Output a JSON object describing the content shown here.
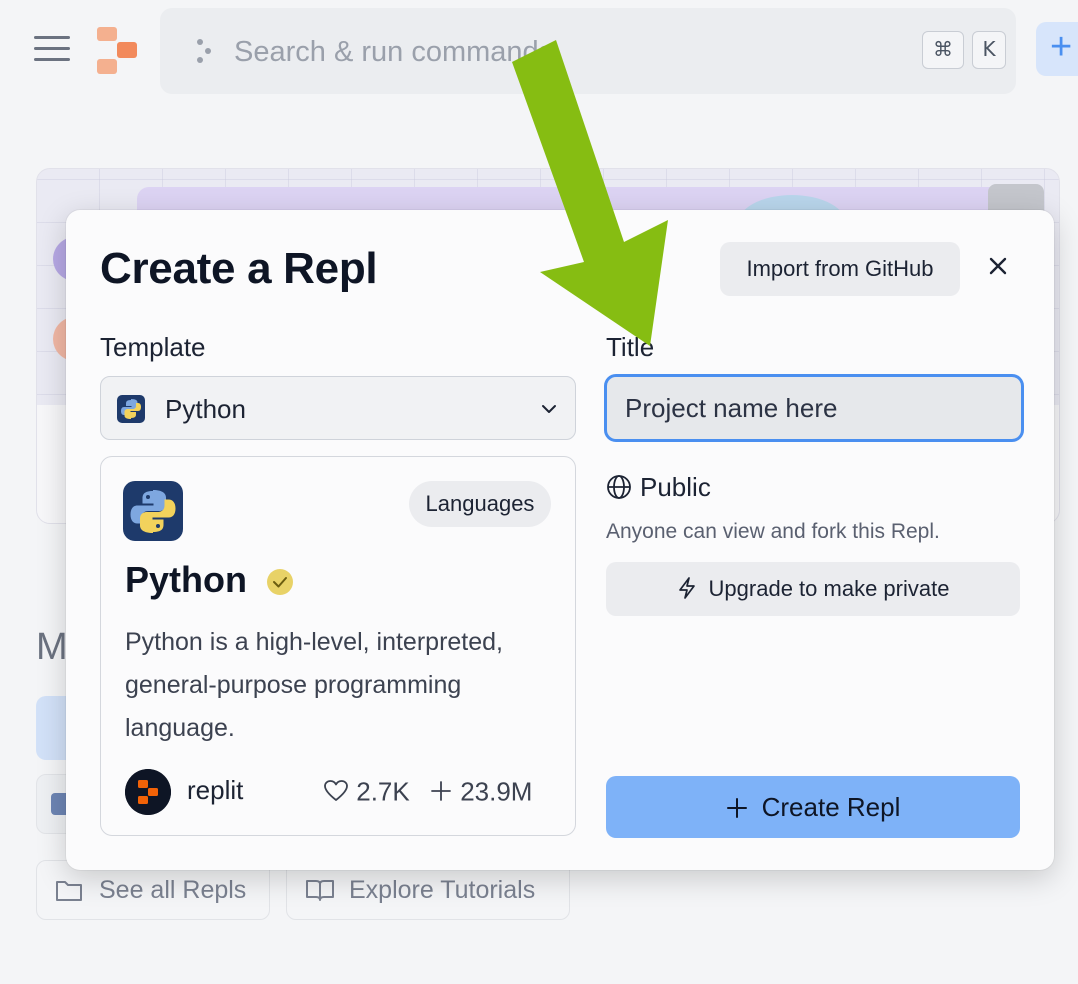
{
  "topbar": {
    "search_placeholder": "Search & run commands",
    "shortcut_keys": [
      "⌘",
      "K"
    ]
  },
  "background": {
    "section_letter": "M",
    "see_all_label": "See all Repls",
    "explore_label": "Explore Tutorials"
  },
  "modal": {
    "title": "Create a Repl",
    "import_label": "Import from GitHub",
    "template_label": "Template",
    "title_label": "Title",
    "selected_template": "Python",
    "title_placeholder": "Project name here",
    "template_card": {
      "category": "Languages",
      "name": "Python",
      "description": "Python is a high-level, interpreted, general-purpose programming language.",
      "owner": "replit",
      "likes": "2.7K",
      "forks": "23.9M"
    },
    "visibility": {
      "label": "Public",
      "description": "Anyone can view and fork this Repl.",
      "upgrade_label": "Upgrade to make private"
    },
    "create_label": "Create Repl"
  },
  "colors": {
    "accent": "#4a8ff0",
    "create_button": "#7eb2f8",
    "annotation_arrow": "#86bd12",
    "logo": "#f26207"
  },
  "icons": [
    "menu-icon",
    "replit-logo",
    "command-icon",
    "plus-icon",
    "close-icon",
    "python-icon",
    "chevron-down-icon",
    "verified-check-icon",
    "heart-icon",
    "fork-plus-icon",
    "globe-icon",
    "lightning-icon",
    "folder-icon",
    "book-icon"
  ]
}
